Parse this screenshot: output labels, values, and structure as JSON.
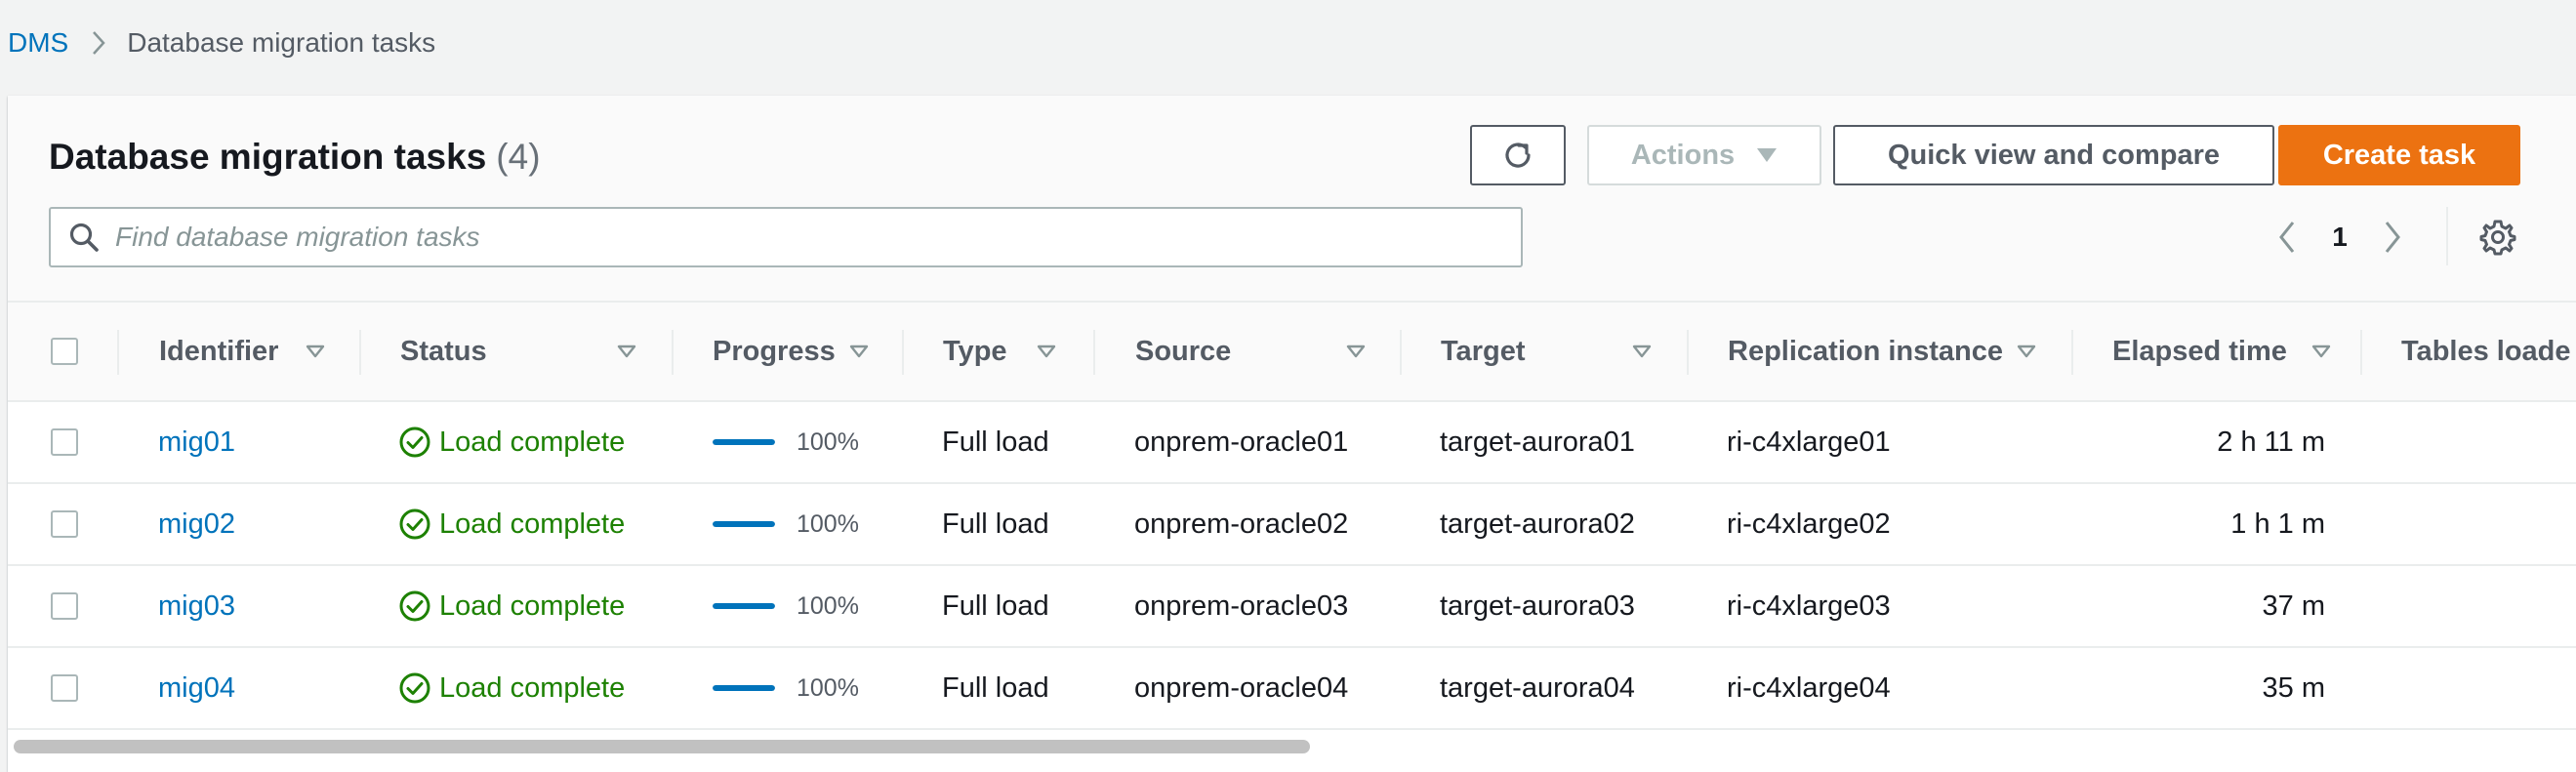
{
  "breadcrumb": {
    "root": "DMS",
    "current": "Database migration tasks"
  },
  "header": {
    "title": "Database migration tasks",
    "count": "(4)"
  },
  "toolbar": {
    "actions_label": "Actions",
    "quick_view_label": "Quick view and compare",
    "create_label": "Create task"
  },
  "search": {
    "placeholder": "Find database migration tasks",
    "value": ""
  },
  "pagination": {
    "current_page": "1"
  },
  "table": {
    "columns": {
      "identifier": "Identifier",
      "status": "Status",
      "progress": "Progress",
      "type": "Type",
      "source": "Source",
      "target": "Target",
      "replication_instance": "Replication instance",
      "elapsed_time": "Elapsed time",
      "tables_loaded": "Tables loade"
    },
    "rows": [
      {
        "identifier": "mig01",
        "status": "Load complete",
        "progress": 1.0,
        "progress_label": "100%",
        "type": "Full load",
        "source": "onprem-oracle01",
        "target": "target-aurora01",
        "replication_instance": "ri-c4xlarge01",
        "elapsed_time": "2 h 11 m"
      },
      {
        "identifier": "mig02",
        "status": "Load complete",
        "progress": 1.0,
        "progress_label": "100%",
        "type": "Full load",
        "source": "onprem-oracle02",
        "target": "target-aurora02",
        "replication_instance": "ri-c4xlarge02",
        "elapsed_time": "1 h 1 m"
      },
      {
        "identifier": "mig03",
        "status": "Load complete",
        "progress": 1.0,
        "progress_label": "100%",
        "type": "Full load",
        "source": "onprem-oracle03",
        "target": "target-aurora03",
        "replication_instance": "ri-c4xlarge03",
        "elapsed_time": "37 m"
      },
      {
        "identifier": "mig04",
        "status": "Load complete",
        "progress": 1.0,
        "progress_label": "100%",
        "type": "Full load",
        "source": "onprem-oracle04",
        "target": "target-aurora04",
        "replication_instance": "ri-c4xlarge04",
        "elapsed_time": "35 m"
      }
    ]
  },
  "colors": {
    "link": "#0073bb",
    "primary": "#ec7211",
    "success": "#1d8102",
    "progress": "#0073bb"
  },
  "icons": {
    "refresh": "refresh-icon",
    "actions_caret": "caret-down-icon",
    "search": "search-icon",
    "prev": "chevron-left-icon",
    "next": "chevron-right-icon",
    "settings": "gear-icon",
    "status": "check-circle-icon",
    "sort": "sort-caret-icon"
  }
}
